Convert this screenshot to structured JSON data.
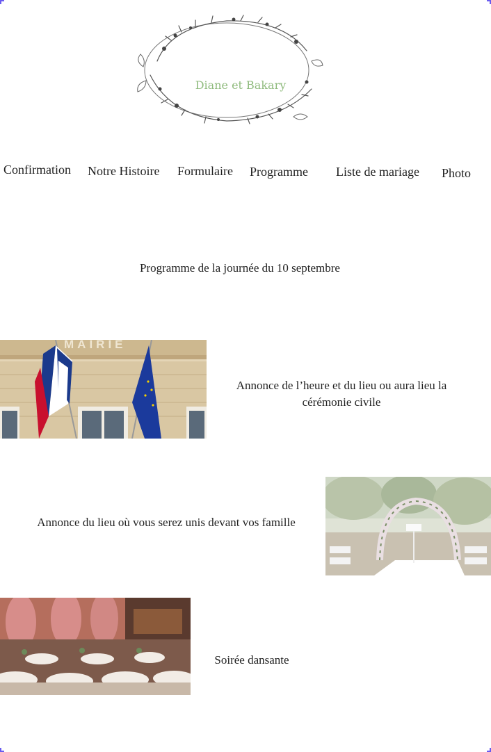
{
  "logo": {
    "couple_name": "Diane et Bakary"
  },
  "nav": {
    "items": [
      {
        "label": "Confirmation"
      },
      {
        "label": "Notre Histoire"
      },
      {
        "label": "Formulaire"
      },
      {
        "label": "Programme"
      },
      {
        "label": "Liste de mariage"
      },
      {
        "label": "Photo"
      }
    ]
  },
  "program": {
    "title": "Programme de la journée du 10 septembre",
    "events": [
      {
        "caption": "Annonce de l’heure et du lieu ou aura lieu la cérémonie civile",
        "image_text": "MAIRIE"
      },
      {
        "caption": "Annonce du lieu où vous serez unis devant vos famille"
      },
      {
        "caption": "Soirée dansante"
      }
    ]
  },
  "colors": {
    "accent": "#8fbb7d",
    "corner_marker": "#6a5cf0"
  }
}
